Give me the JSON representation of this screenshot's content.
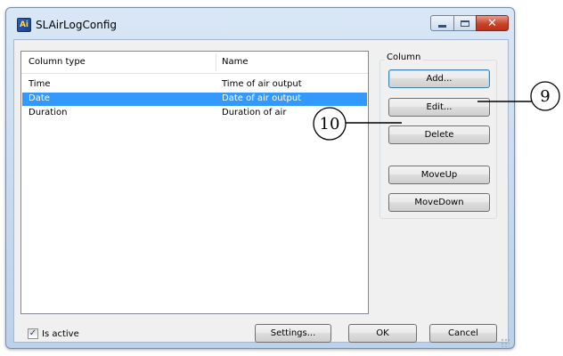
{
  "window": {
    "title": "SLAirLogConfig",
    "icon": "app-icon",
    "icon_text": "Ai"
  },
  "list": {
    "columns": [
      "Column type",
      "Name"
    ],
    "rows": [
      {
        "type": "Time",
        "name": "Time of air output",
        "selected": false
      },
      {
        "type": "Date",
        "name": "Date of air output",
        "selected": true
      },
      {
        "type": "Duration",
        "name": "Duration of air",
        "selected": false
      }
    ]
  },
  "column_group": {
    "label": "Column",
    "add": "Add...",
    "edit": "Edit...",
    "delete": "Delete",
    "move_up": "MoveUp",
    "move_down": "MoveDown"
  },
  "footer": {
    "is_active_label": "Is active",
    "is_active_checked": true,
    "settings": "Settings...",
    "ok": "OK",
    "cancel": "Cancel"
  },
  "callouts": [
    "9",
    "10"
  ],
  "colors": {
    "selection": "#3399ff",
    "close_button": "#c7432a"
  }
}
